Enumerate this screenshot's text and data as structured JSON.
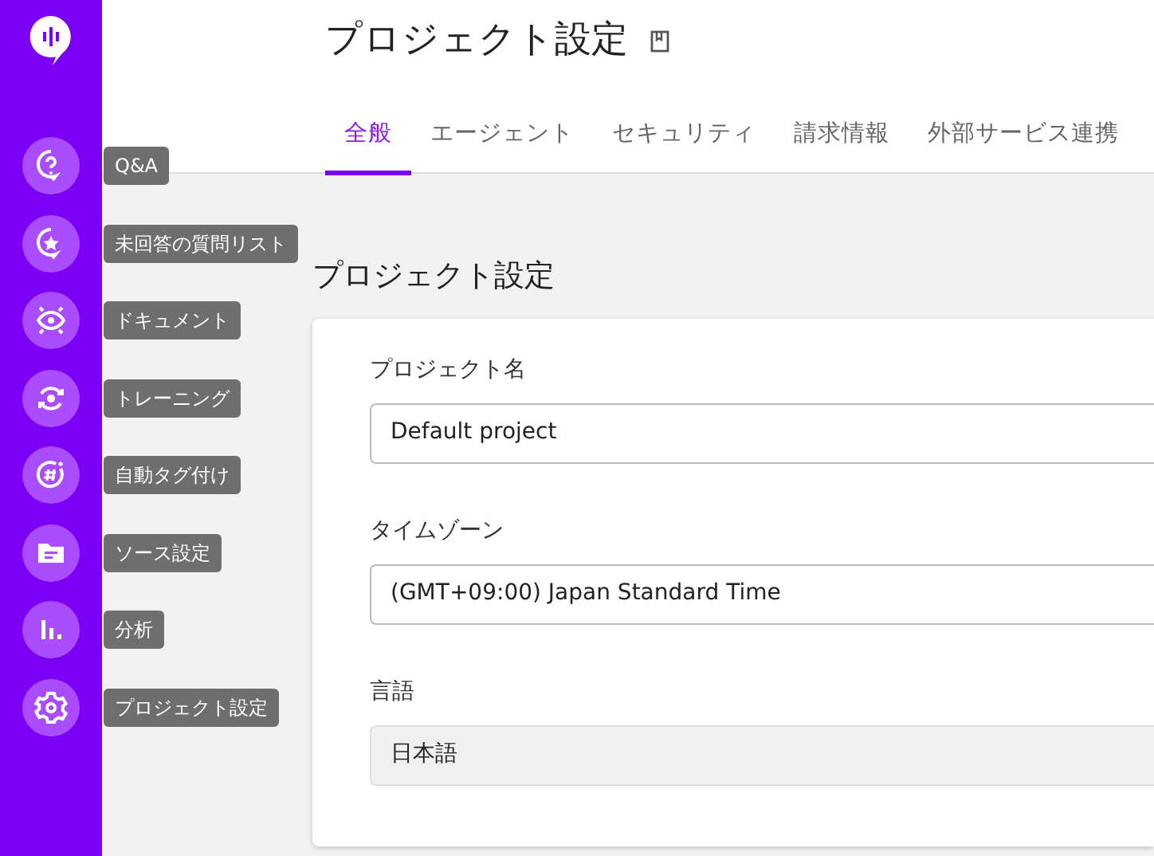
{
  "sidebar": {
    "items": [
      {
        "tooltip": "Q&A"
      },
      {
        "tooltip": "未回答の質問リスト"
      },
      {
        "tooltip": "ドキュメント"
      },
      {
        "tooltip": "トレーニング"
      },
      {
        "tooltip": "自動タグ付け"
      },
      {
        "tooltip": "ソース設定"
      },
      {
        "tooltip": "分析"
      },
      {
        "tooltip": "プロジェクト設定"
      }
    ]
  },
  "header": {
    "title": "プロジェクト設定"
  },
  "tabs": [
    {
      "label": "全般",
      "selected": true
    },
    {
      "label": "エージェント",
      "selected": false
    },
    {
      "label": "セキュリティ",
      "selected": false
    },
    {
      "label": "請求情報",
      "selected": false
    },
    {
      "label": "外部サービス連携",
      "selected": false
    }
  ],
  "section": {
    "title": "プロジェクト設定",
    "fields": [
      {
        "label": "プロジェクト名",
        "value": "Default project",
        "disabled": false
      },
      {
        "label": "タイムゾーン",
        "value": "(GMT+09:00) Japan Standard Time",
        "disabled": false
      },
      {
        "label": "言語",
        "value": "日本語",
        "disabled": true
      }
    ]
  }
}
